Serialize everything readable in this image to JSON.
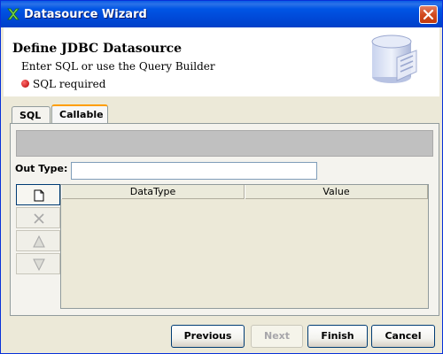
{
  "window": {
    "title": "Datasource Wizard",
    "title_icon": "wizard-x-icon",
    "close_icon": "close-icon"
  },
  "header": {
    "title": "Define JDBC Datasource",
    "subtitle": "Enter SQL or use the Query Builder",
    "status": "SQL required",
    "status_color": "#cc0000",
    "graphic": "database-icon"
  },
  "tabs": [
    {
      "label": "SQL",
      "selected": false
    },
    {
      "label": "Callable",
      "selected": true
    }
  ],
  "callable": {
    "out_type_label": "Out Type:",
    "out_type_value": "",
    "side_buttons": [
      {
        "icon": "new-document-icon",
        "enabled": true
      },
      {
        "icon": "delete-x-icon",
        "enabled": false
      },
      {
        "icon": "move-up-icon",
        "enabled": false
      },
      {
        "icon": "move-down-icon",
        "enabled": false
      }
    ],
    "table": {
      "columns": [
        "DataType",
        "Value"
      ],
      "rows": []
    }
  },
  "footer": {
    "previous": "Previous",
    "next": "Next",
    "finish": "Finish",
    "cancel": "Cancel"
  },
  "colors": {
    "titlebar": "#0054e3",
    "window_bg": "#ece9d8",
    "accent_tab": "#ff9e00"
  }
}
